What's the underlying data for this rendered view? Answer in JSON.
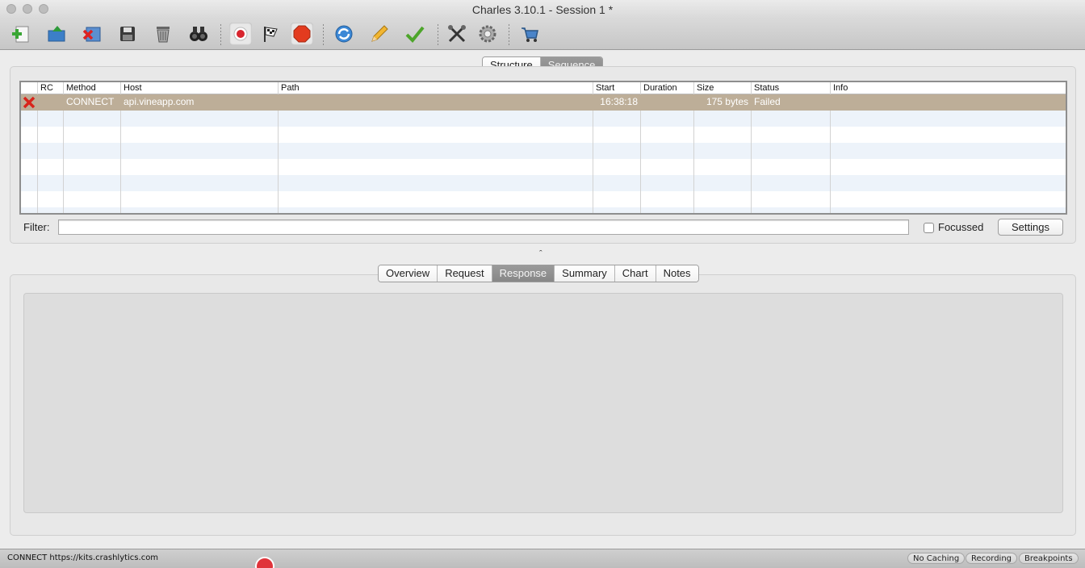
{
  "window": {
    "title": "Charles 3.10.1 - Session 1 *"
  },
  "toolbar": {
    "icons": [
      "new-session-icon",
      "open-session-icon",
      "close-session-icon",
      "save-icon",
      "clear-icon",
      "find-icon",
      "record-icon",
      "throttle-icon",
      "breakpoints-icon",
      "repeat-icon",
      "edit-icon",
      "validate-icon",
      "tools-icon",
      "settings-icon",
      "shop-icon"
    ]
  },
  "view_tabs": [
    {
      "label": "Structure",
      "active": false
    },
    {
      "label": "Sequence",
      "active": true
    }
  ],
  "table": {
    "columns": [
      "",
      "RC",
      "Method",
      "Host",
      "Path",
      "Start",
      "Duration",
      "Size",
      "Status",
      "Info"
    ],
    "rows": [
      {
        "status_icon": "failed-x-icon",
        "rc": "",
        "method": "CONNECT",
        "host": "api.vineapp.com",
        "path": "",
        "start": "16:38:18",
        "duration": "",
        "size": "175 bytes",
        "status": "Failed",
        "info": ""
      }
    ]
  },
  "filter": {
    "label": "Filter:",
    "value": "",
    "focussed_label": "Focussed",
    "focussed_checked": false,
    "settings_label": "Settings"
  },
  "splitter": {
    "glyph": "ˆ"
  },
  "detail_tabs": [
    {
      "label": "Overview",
      "active": false
    },
    {
      "label": "Request",
      "active": false
    },
    {
      "label": "Response",
      "active": true
    },
    {
      "label": "Summary",
      "active": false
    },
    {
      "label": "Chart",
      "active": false
    },
    {
      "label": "Notes",
      "active": false
    }
  ],
  "statusbar": {
    "text": "CONNECT https://kits.crashlytics.com",
    "pills": [
      "No Caching",
      "Recording",
      "Breakpoints"
    ]
  },
  "colors": {
    "selected_row": "#bdae98",
    "active_tab": "#8f8f8f"
  }
}
